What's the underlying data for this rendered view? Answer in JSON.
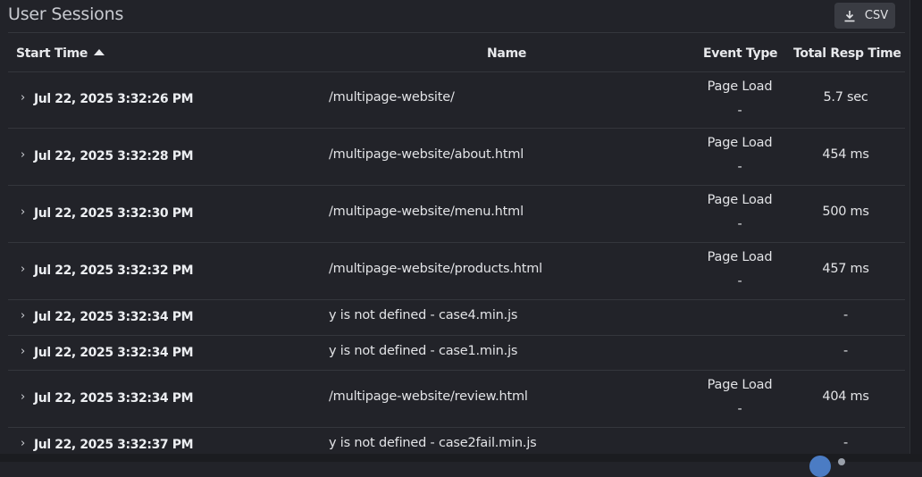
{
  "panel": {
    "title": "User Sessions",
    "csv_button": {
      "icon": "download-icon",
      "label": "CSV"
    }
  },
  "table": {
    "columns": [
      {
        "label": "Start Time",
        "sort": "ascending"
      },
      {
        "label": "Name"
      },
      {
        "label": "Event Type"
      },
      {
        "label": "Total Resp Time"
      }
    ],
    "rows": [
      {
        "time": "Jul 22, 2025 3:32:26 PM",
        "name": "/multipage-website/",
        "event_type": "Page Load",
        "event_sub": "-",
        "resp": "5.7 sec"
      },
      {
        "time": "Jul 22, 2025 3:32:28 PM",
        "name": "/multipage-website/about.html",
        "event_type": "Page Load",
        "event_sub": "-",
        "resp": "454 ms"
      },
      {
        "time": "Jul 22, 2025 3:32:30 PM",
        "name": "/multipage-website/menu.html",
        "event_type": "Page Load",
        "event_sub": "-",
        "resp": "500 ms"
      },
      {
        "time": "Jul 22, 2025 3:32:32 PM",
        "name": "/multipage-website/products.html",
        "event_type": "Page Load",
        "event_sub": "-",
        "resp": "457 ms"
      },
      {
        "time": "Jul 22, 2025 3:32:34 PM",
        "name": "y is not defined - case4.min.js",
        "event_type": "",
        "event_sub": "",
        "resp": "-"
      },
      {
        "time": "Jul 22, 2025 3:32:34 PM",
        "name": "y is not defined - case1.min.js",
        "event_type": "",
        "event_sub": "",
        "resp": "-"
      },
      {
        "time": "Jul 22, 2025 3:32:34 PM",
        "name": "/multipage-website/review.html",
        "event_type": "Page Load",
        "event_sub": "-",
        "resp": "404 ms"
      },
      {
        "time": "Jul 22, 2025 3:32:37 PM",
        "name": "y is not defined - case2fail.min.js",
        "event_type": "",
        "event_sub": "",
        "resp": "-"
      }
    ],
    "row_expand_icon": "chevron-right-icon"
  },
  "colors": {
    "background": "#222329",
    "divider": "#34363c",
    "button_bg": "#3a3c43",
    "text": "#e6e7ea"
  }
}
